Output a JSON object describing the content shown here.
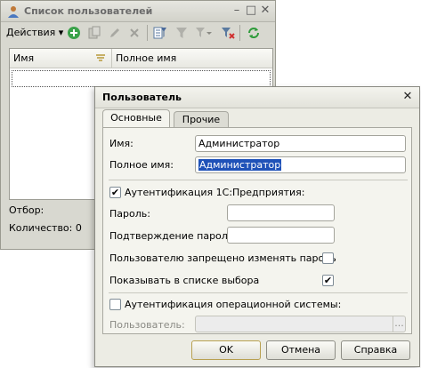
{
  "list_window": {
    "title": "Список пользователей",
    "toolbar": {
      "actions_label": "Действия",
      "actions_arrow": "▾",
      "add_icon": "add-icon",
      "copy_icon": "copy-icon",
      "edit_icon": "pencil-icon",
      "delete_icon": "delete-icon",
      "filter_icon": "filter-icon",
      "refresh_icon": "refresh-icon"
    },
    "columns": [
      "Имя",
      "Полное имя"
    ],
    "filter_label": "Отбор:",
    "count_label": "Количество: 0"
  },
  "dialog": {
    "title": "Пользователь",
    "tabs": [
      "Основные",
      "Прочие"
    ],
    "fields": {
      "name_label": "Имя:",
      "name_value": "Администратор",
      "fullname_label": "Полное имя:",
      "fullname_value": "Администратор",
      "auth_1c_label": "Аутентификация 1С:Предприятия:",
      "auth_1c_checked": true,
      "password_label": "Пароль:",
      "password_confirm_label": "Подтверждение пароля:",
      "forbid_change_label": "Пользователю запрещено изменять пароль",
      "forbid_change_checked": false,
      "show_in_list_label": "Показывать в списке выбора",
      "show_in_list_checked": true,
      "auth_os_label": "Аутентификация операционной системы:",
      "auth_os_checked": false,
      "os_user_label": "Пользователь:",
      "os_user_button": "..."
    },
    "buttons": {
      "ok": "OK",
      "cancel": "Отмена",
      "help": "Справка"
    }
  },
  "colors": {
    "accent": "#2e9b3a",
    "selection": "#1f52b8",
    "window_bg": "#ecece4"
  }
}
